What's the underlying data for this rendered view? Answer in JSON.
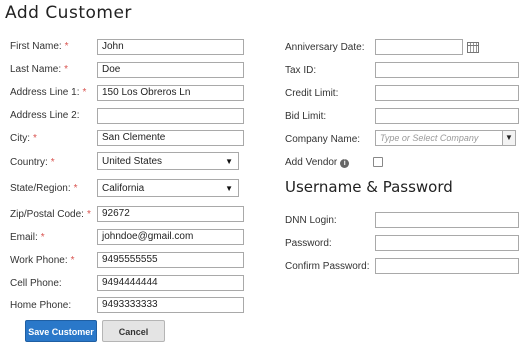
{
  "title": "Add Customer",
  "left_fields": {
    "first_name": {
      "label": "First Name:",
      "required": "*",
      "value": "John"
    },
    "last_name": {
      "label": "Last Name:",
      "required": "*",
      "value": "Doe"
    },
    "address1": {
      "label": "Address Line 1:",
      "required": "*",
      "value": "150 Los Obreros Ln"
    },
    "address2": {
      "label": "Address Line 2:",
      "value": ""
    },
    "city": {
      "label": "City:",
      "required": "*",
      "value": "San Clemente"
    },
    "country": {
      "label": "Country:",
      "required": "*",
      "value": "United States"
    },
    "state": {
      "label": "State/Region:",
      "required": "*",
      "value": "California"
    },
    "zip": {
      "label": "Zip/Postal Code:",
      "required": "*",
      "value": "92672"
    },
    "email": {
      "label": "Email:",
      "required": "*",
      "value": "johndoe@gmail.com"
    },
    "work_phone": {
      "label": "Work Phone:",
      "required": "*",
      "value": "9495555555"
    },
    "cell_phone": {
      "label": "Cell Phone:",
      "value": "9494444444"
    },
    "home_phone": {
      "label": "Home Phone:",
      "value": "9493333333"
    }
  },
  "right_fields": {
    "anniversary": {
      "label": "Anniversary Date:",
      "value": ""
    },
    "tax_id": {
      "label": "Tax ID:",
      "value": ""
    },
    "credit_limit": {
      "label": "Credit Limit:",
      "value": ""
    },
    "bid_limit": {
      "label": "Bid Limit:",
      "value": ""
    },
    "company": {
      "label": "Company Name:",
      "placeholder": "Type or Select Company"
    },
    "add_vendor": {
      "label": "Add Vendor",
      "info": "i",
      "checked": false
    }
  },
  "credentials": {
    "heading": "Username & Password",
    "dnn_login": {
      "label": "DNN Login:",
      "value": ""
    },
    "password": {
      "label": "Password:",
      "value": ""
    },
    "confirm_password": {
      "label": "Confirm Password:",
      "value": ""
    }
  },
  "buttons": {
    "save": "Save Customer",
    "cancel": "Cancel"
  },
  "icons": {
    "dropdown": "▼",
    "calendar": "calendar-icon",
    "info": "info-icon"
  },
  "colors": {
    "required": "#d9534f",
    "primary_button": "#2a78c9"
  }
}
